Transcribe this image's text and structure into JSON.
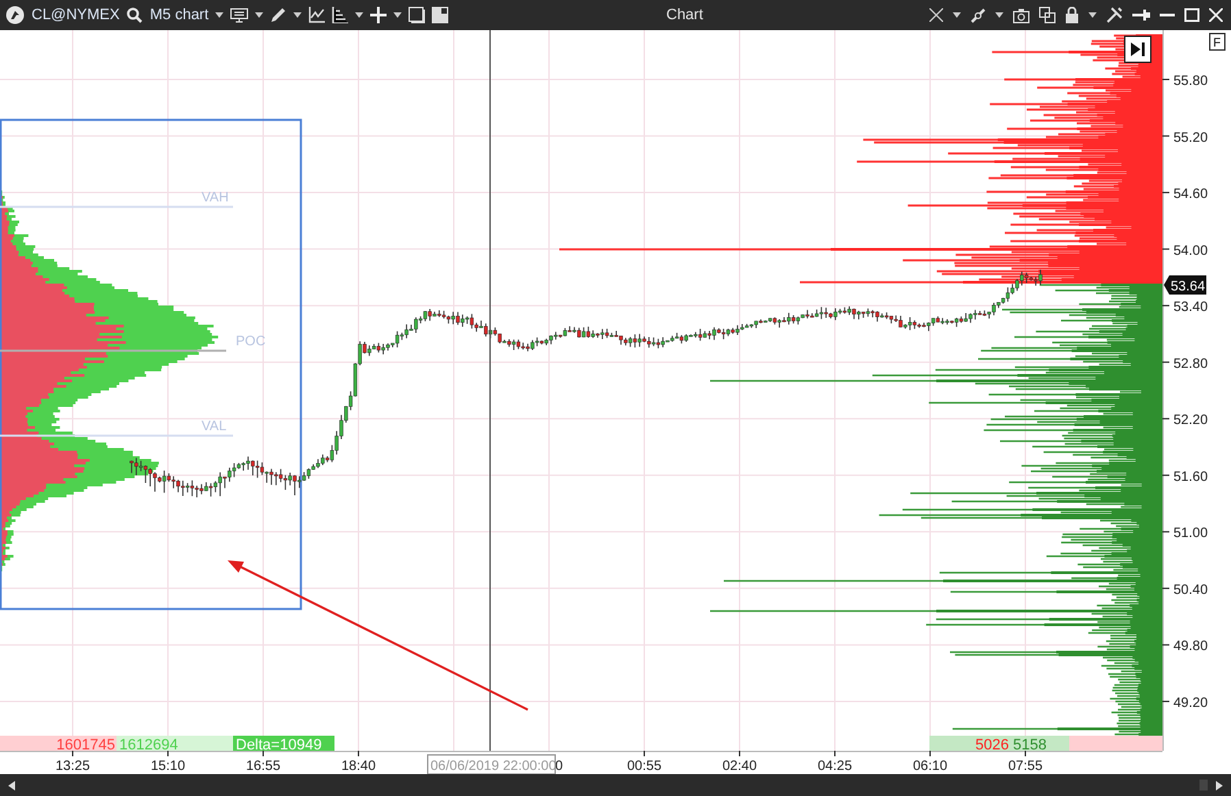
{
  "toolbar": {
    "symbol": "CL@NYMEX",
    "chart_name": "M5 chart",
    "title": "Chart"
  },
  "profile_levels": [
    {
      "label": "VAH"
    },
    {
      "label": "POC"
    },
    {
      "label": "VAL"
    }
  ],
  "price_axis": {
    "labels": [
      "55.80",
      "55.20",
      "54.60",
      "54.00",
      "53.40",
      "52.80",
      "52.20",
      "51.60",
      "51.00",
      "50.40",
      "49.80",
      "49.20"
    ],
    "current_price": "53.64"
  },
  "time_axis": {
    "labels": [
      "13:25",
      "15:10",
      "16:55",
      "18:40",
      "00:55",
      "02:40",
      "04:25",
      "06:10",
      "07:55"
    ],
    "cursor_time": "06/06/2019 22:00:00",
    "covered_fragment": "0"
  },
  "left_stats": {
    "sell": "1601745",
    "buy": "1612694",
    "delta": "Delta=10949"
  },
  "right_stats": {
    "sell": "5026",
    "buy": "5158"
  },
  "f_button": "F"
}
